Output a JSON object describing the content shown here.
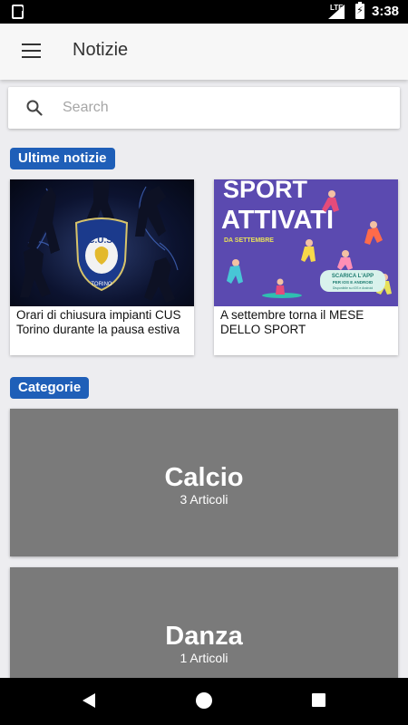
{
  "status_bar": {
    "network": "LTE",
    "time": "3:38"
  },
  "app_bar": {
    "title": "Notizie",
    "menu_icon": "hamburger-menu-icon"
  },
  "search": {
    "placeholder": "Search",
    "value": "",
    "icon": "search-icon"
  },
  "latest": {
    "label": "Ultime notizie",
    "items": [
      {
        "title": "Orari di chiusura impianti CUS Torino durante la pausa estiva",
        "image": {
          "crest_text": "C.U.S.",
          "caption": "TORINO"
        }
      },
      {
        "title": "A settembre torna il MESE DELLO SPORT",
        "image": {
          "line1": "SPORT",
          "line2": "ATTIVATI",
          "sub": "DA SETTEMBRE",
          "app_line1": "SCARICA L'APP",
          "app_line2": "PER IOS E ANDROID",
          "app_line3": "Disponibile su iOS e Android"
        }
      }
    ]
  },
  "categories": {
    "label": "Categorie",
    "items": [
      {
        "name": "Calcio",
        "count": "3 Articoli"
      },
      {
        "name": "Danza",
        "count": "1 Articoli"
      }
    ]
  },
  "colors": {
    "accent": "#1f5fb8",
    "category_bg": "#7a7a7a",
    "background": "#ededf0"
  }
}
